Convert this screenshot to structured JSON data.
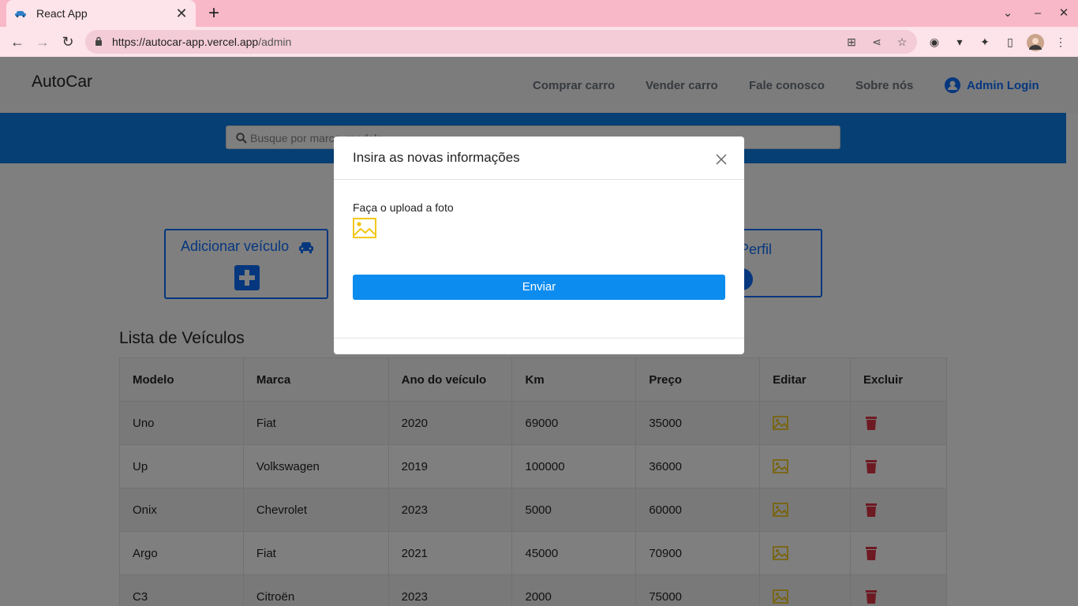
{
  "browser": {
    "tab_title": "React App",
    "url_host": "https://autocar-app.vercel.app",
    "url_path": "/admin"
  },
  "site": {
    "brand": "AutoCar",
    "nav": [
      "Comprar carro",
      "Vender carro",
      "Fale conosco",
      "Sobre nós"
    ],
    "admin_login": "Admin Login",
    "search_placeholder": "Busque por marca, modelo"
  },
  "cards": {
    "add_vehicle": "Adicionar veículo",
    "profile": "r Perfil"
  },
  "list_title": "Lista de Veículos",
  "table": {
    "headers": [
      "Modelo",
      "Marca",
      "Ano do veículo",
      "Km",
      "Preço",
      "Editar",
      "Excluir"
    ],
    "rows": [
      [
        "Uno",
        "Fiat",
        "2020",
        "69000",
        "35000"
      ],
      [
        "Up",
        "Volkswagen",
        "2019",
        "100000",
        "36000"
      ],
      [
        "Onix",
        "Chevrolet",
        "2023",
        "5000",
        "60000"
      ],
      [
        "Argo",
        "Fiat",
        "2021",
        "45000",
        "70900"
      ],
      [
        "C3",
        "Citroën",
        "2023",
        "2000",
        "75000"
      ]
    ]
  },
  "modal": {
    "title": "Insira as novas informações",
    "upload_label": "Faça o upload a foto",
    "submit": "Enviar"
  },
  "colors": {
    "primary": "#0d6efd",
    "band": "#0d7fe6",
    "edit_icon": "#f2c200",
    "delete_icon": "#dc3545",
    "tab_bar": "#f9b8c8"
  }
}
